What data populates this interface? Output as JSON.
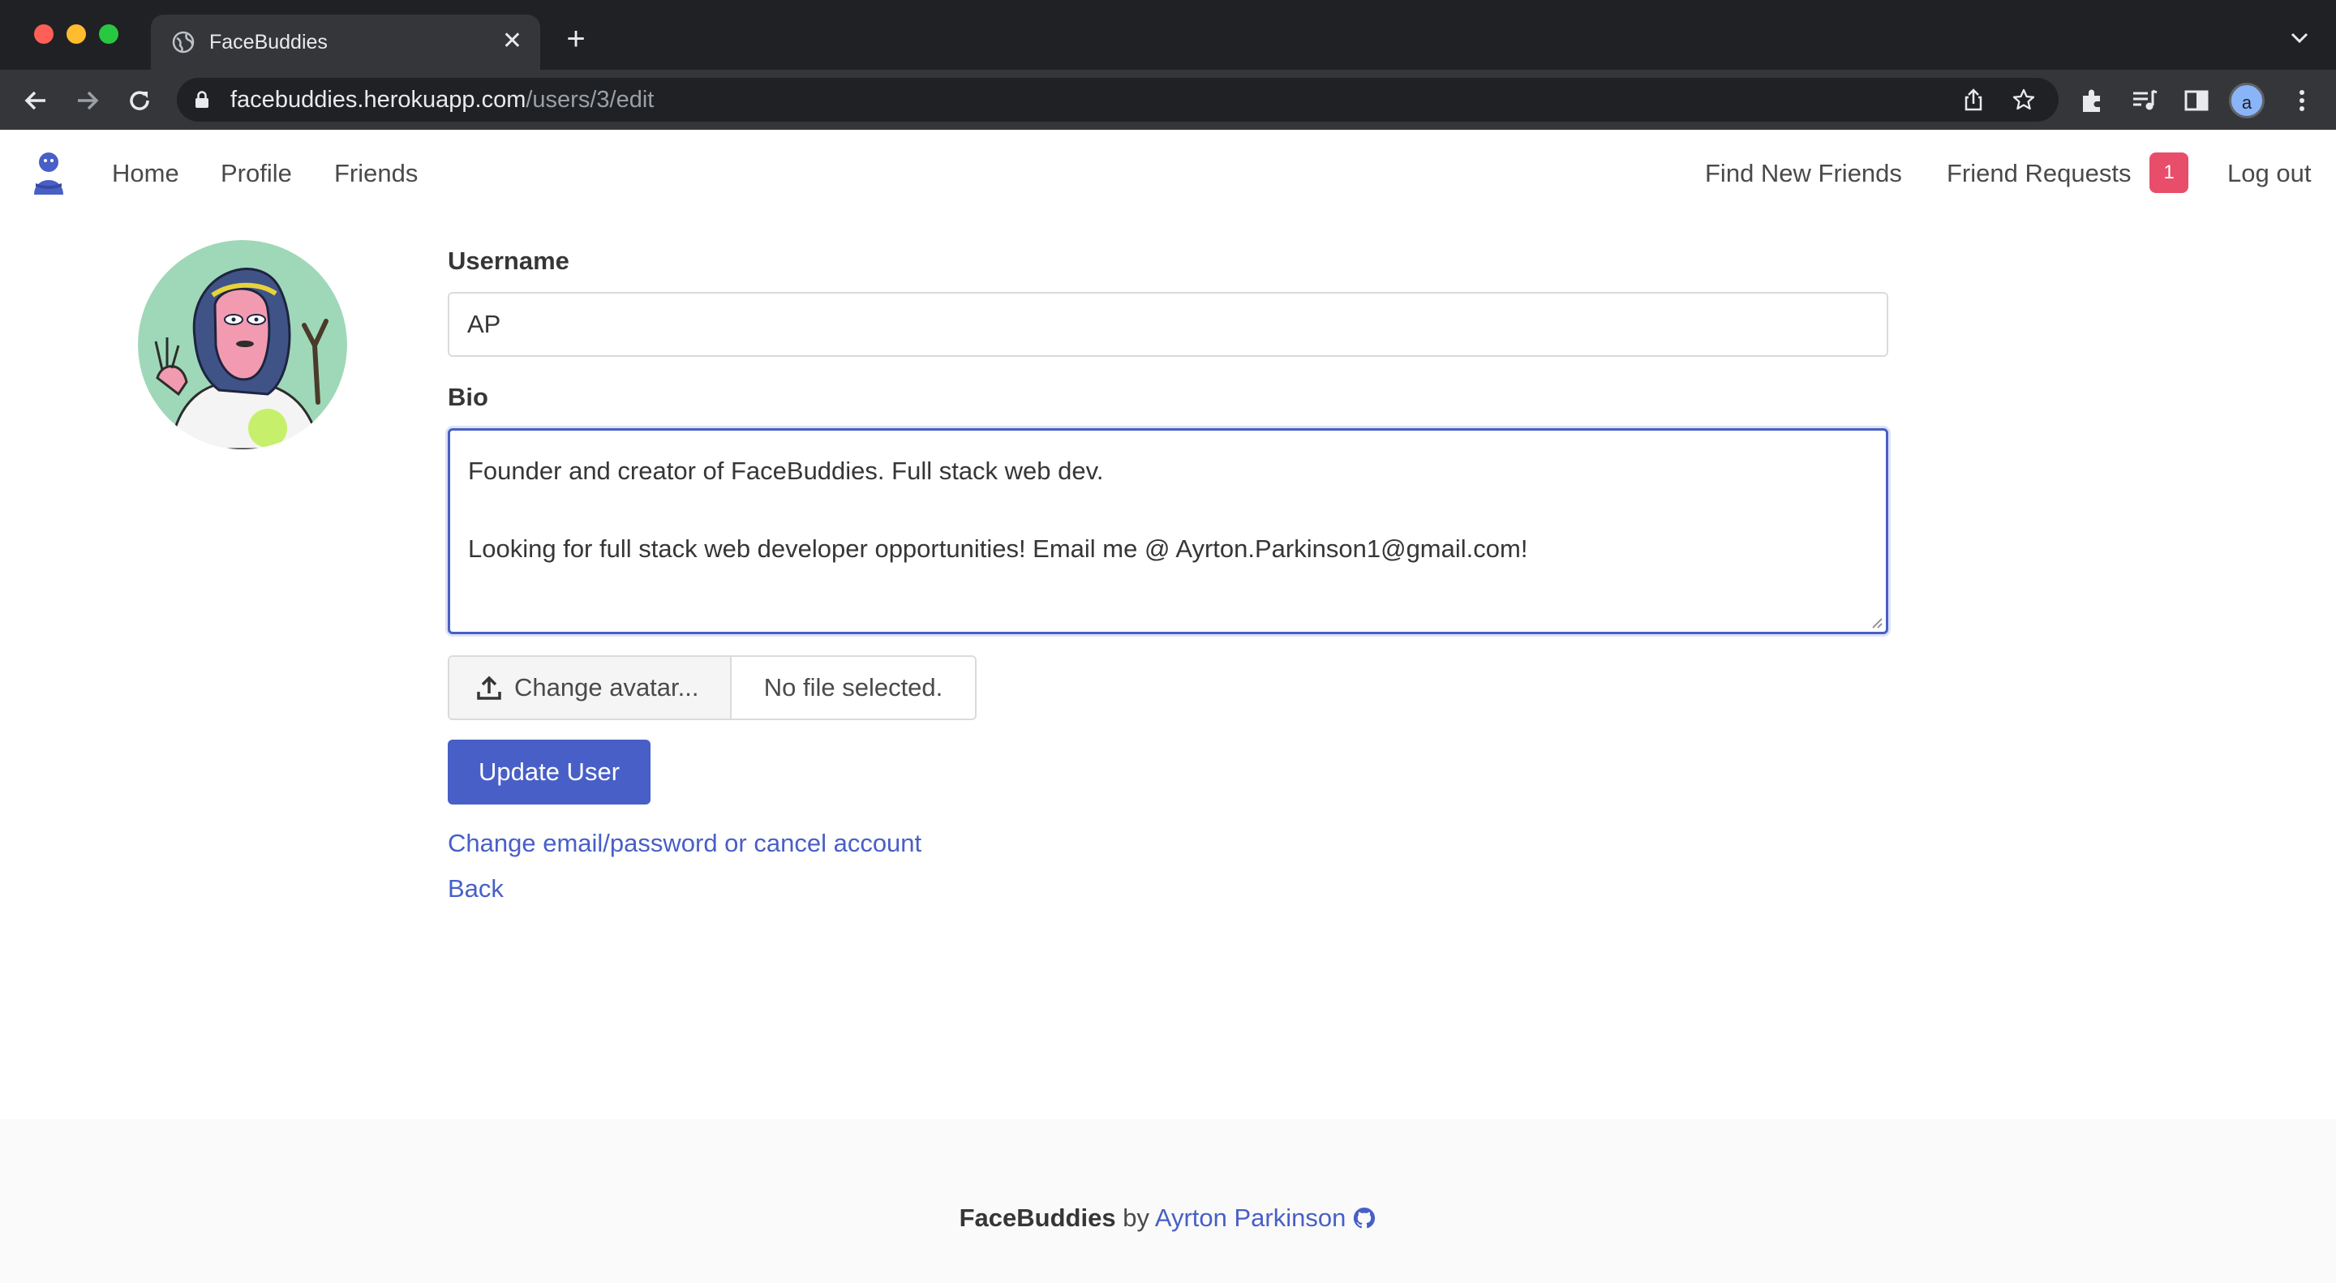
{
  "browser": {
    "tab_title": "FaceBuddies",
    "url_host": "facebuddies.herokuapp.com",
    "url_path": "/users/3/edit",
    "profile_initial": "a"
  },
  "nav": {
    "home": "Home",
    "profile": "Profile",
    "friends": "Friends",
    "find_new_friends": "Find New Friends",
    "friend_requests": "Friend Requests",
    "friend_requests_count": "1",
    "log_out": "Log out"
  },
  "form": {
    "username_label": "Username",
    "username_value": "AP",
    "bio_label": "Bio",
    "bio_line1": "Founder and creator of FaceBuddies. Full stack web dev.",
    "bio_line2": "Looking for full stack web developer opportunities! Email me @ Ayrton.Parkinson1@gmail.com!",
    "file_button": "Change avatar...",
    "file_status": "No file selected.",
    "submit": "Update User"
  },
  "links": {
    "account": "Change email/password or cancel account",
    "back": "Back"
  },
  "footer": {
    "brand": "FaceBuddies",
    "by": "by",
    "author": "Ayrton Parkinson"
  },
  "colors": {
    "primary": "#485fc7",
    "badge": "#e84d6a",
    "avatar_bg": "#9fd8b8"
  }
}
